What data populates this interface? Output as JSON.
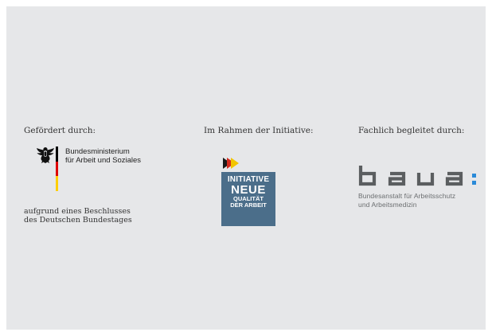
{
  "columns": {
    "funded": {
      "heading": "Gefördert durch:",
      "ministry_line1": "Bundesministerium",
      "ministry_line2": "für Arbeit und Soziales",
      "note_line1": "aufgrund eines Beschlusses",
      "note_line2": "des Deutschen Bundestages",
      "flag_colors": [
        "#000000",
        "#dd0000",
        "#ffce00"
      ]
    },
    "initiative": {
      "heading": "Im Rahmen der Initiative:",
      "logo_line1": "INITIATIVE",
      "logo_line2": "NEUE",
      "logo_line3": "QUALITÄT",
      "logo_line4": "DER ARBEIT",
      "box_color": "#4b6e8a"
    },
    "accompanied": {
      "heading": "Fachlich begleitet durch:",
      "sub_line1": "Bundesanstalt für Arbeitsschutz",
      "sub_line2": "und Arbeitsmedizin",
      "mark_color": "#5b5e60",
      "colon_color": "#2a8ad8"
    }
  },
  "icons": {
    "eagle": "federal-eagle-icon",
    "arrows": "inqa-arrows-icon",
    "baua_wordmark": "baua-wordmark-icon"
  }
}
